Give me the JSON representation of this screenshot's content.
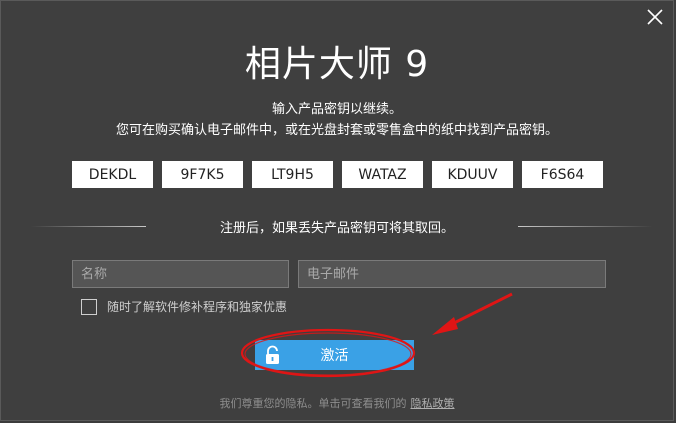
{
  "dialog": {
    "title": "相片大师 9",
    "subtitle1": "输入产品密钥以继续。",
    "subtitle2": "您可在购买确认电子邮件中，或在光盘封套或零售盒中的纸中找到产品密钥。",
    "keys": [
      "DEKDL",
      "9F7K5",
      "LT9H5",
      "WATAZ",
      "KDUUV",
      "F6S64"
    ],
    "register_text": "注册后，如果丢失产品密钥可将其取回。",
    "name_placeholder": "名称",
    "email_placeholder": "电子邮件",
    "checkbox_label": "随时了解软件修补程序和独家优惠",
    "activate_label": "激活",
    "footer_text": "我们尊重您的隐私。单击可查看我们的",
    "footer_link": "隐私政策"
  },
  "icons": {
    "close": "close-icon",
    "lock": "unlock-icon",
    "annotation_arrow": "arrow-annotation",
    "annotation_circle": "ellipse-annotation"
  },
  "colors": {
    "background": "#3f3f3f",
    "accent": "#3aa1e6",
    "annotation": "#e01515"
  }
}
